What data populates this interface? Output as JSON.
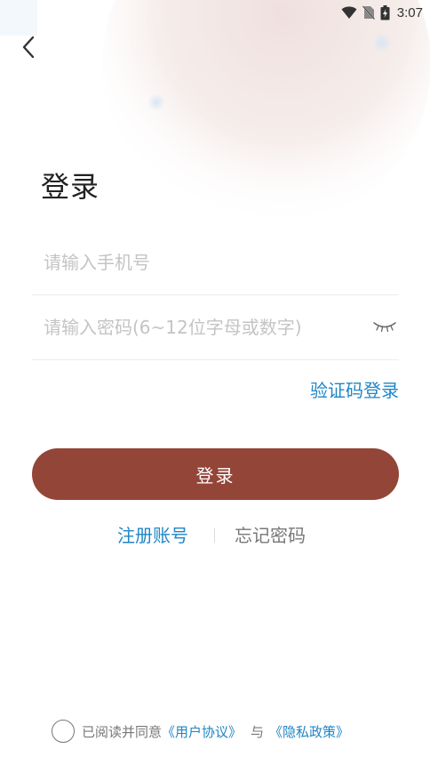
{
  "status_bar": {
    "time": "3:07",
    "icons": [
      "wifi-icon",
      "no-sim-icon",
      "battery-charging-icon"
    ]
  },
  "header": {
    "back_icon": "chevron-left-icon"
  },
  "page": {
    "title": "登录"
  },
  "form": {
    "phone_placeholder": "请输入手机号",
    "phone_value": "",
    "password_placeholder": "请输入密码(6~12位字母或数字)",
    "password_value": "",
    "password_toggle_icon": "eye-closed-icon",
    "sms_login_label": "验证码登录",
    "submit_label": "登录"
  },
  "links": {
    "register_label": "注册账号",
    "forgot_label": "忘记密码"
  },
  "agreement": {
    "prefix": "已阅读并同意",
    "user_agreement": "《用户协议》",
    "conjunction": "与",
    "privacy_policy": "《隐私政策》"
  },
  "colors": {
    "primary_button": "#934538",
    "link_blue": "#1f86c6",
    "placeholder": "#c4c4c4"
  }
}
